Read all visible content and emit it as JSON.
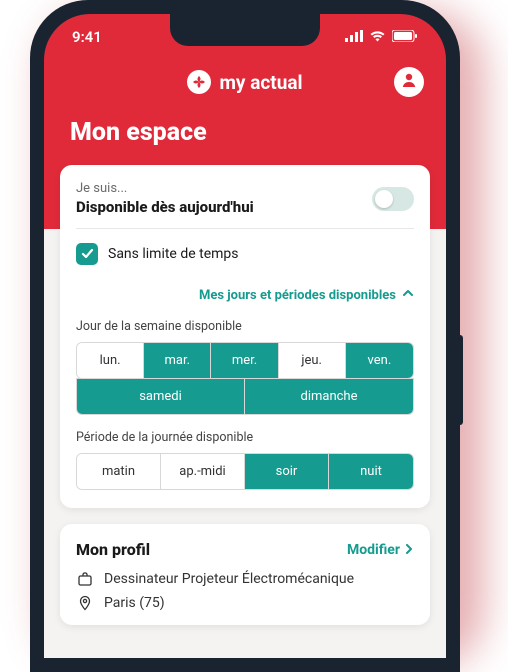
{
  "statusbar": {
    "time": "9:41"
  },
  "header": {
    "brand": "my actual"
  },
  "page": {
    "title": "Mon espace"
  },
  "availability": {
    "prefix": "Je suis...",
    "status": "Disponible dès aujourd'hui",
    "unlimited_label": "Sans limite de temps",
    "accordion_label": "Mes jours et périodes disponibles",
    "days_label": "Jour de la semaine disponible",
    "periods_label": "Période de la journée disponible",
    "days": {
      "mon": "lun.",
      "tue": "mar.",
      "wed": "mer.",
      "thu": "jeu.",
      "fri": "ven.",
      "sat": "samedi",
      "sun": "dimanche"
    },
    "periods": {
      "morning": "matin",
      "afternoon": "ap.-midi",
      "evening": "soir",
      "night": "nuit"
    }
  },
  "profile": {
    "title": "Mon profil",
    "edit": "Modifier",
    "job": "Dessinateur Projeteur Électromécanique",
    "location": "Paris (75)"
  },
  "colors": {
    "brand_red": "#e02a3a",
    "teal": "#159b8f"
  }
}
